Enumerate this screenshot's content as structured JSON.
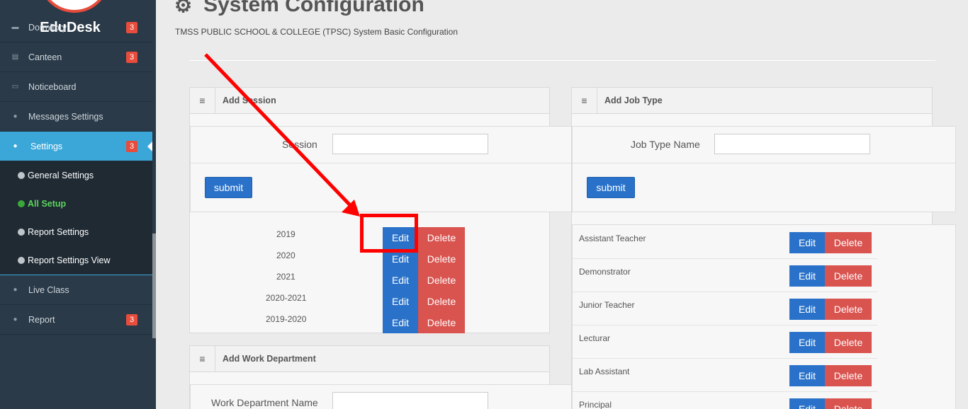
{
  "sidebar": {
    "brand": "EduDesk",
    "items": [
      {
        "label": "Dormitory",
        "badge": "3",
        "icon": "bed-icon"
      },
      {
        "label": "Canteen",
        "badge": "3",
        "icon": "id-card-icon"
      },
      {
        "label": "Noticeboard",
        "badge": "",
        "icon": "window-icon"
      },
      {
        "label": "Messages Settings",
        "badge": "",
        "icon": "chat-icon"
      },
      {
        "label": "Settings",
        "badge": "3",
        "icon": "info-icon"
      },
      {
        "label": "Live Class",
        "badge": "",
        "icon": "chat-icon"
      },
      {
        "label": "Report",
        "badge": "3",
        "icon": "info-icon"
      }
    ],
    "submenu": [
      {
        "label": "General Settings"
      },
      {
        "label": "All Setup"
      },
      {
        "label": "Report Settings"
      },
      {
        "label": "Report Settings View"
      }
    ]
  },
  "header": {
    "title": "System Configuration",
    "subtitle": "TMSS PUBLIC SCHOOL & COLLEGE (TPSC) System Basic Configuration"
  },
  "session_panel": {
    "title": "Add Session",
    "field_label": "Session",
    "field_value": "",
    "submit_label": "submit",
    "rows": [
      "2019",
      "2020",
      "2021",
      "2020-2021",
      "2019-2020"
    ],
    "edit_label": "Edit",
    "delete_label": "Delete"
  },
  "department_panel": {
    "title": "Add Work Department",
    "field_label": "Work Department Name",
    "field_value": ""
  },
  "jobtype_panel": {
    "title": "Add Job Type",
    "field_label": "Job Type Name",
    "field_value": "",
    "submit_label": "submit",
    "rows": [
      "Assistant Teacher",
      "Demonstrator",
      "Junior Teacher",
      "Lecturar",
      "Lab Assistant",
      "Principal"
    ],
    "edit_label": "Edit",
    "delete_label": "Delete"
  },
  "colors": {
    "sidebar_bg": "#2a3a48",
    "active": "#3ba7d9",
    "badge": "#e74c3c",
    "primary": "#2a72c9",
    "danger": "#d9534f",
    "annotation": "#ff0000"
  }
}
